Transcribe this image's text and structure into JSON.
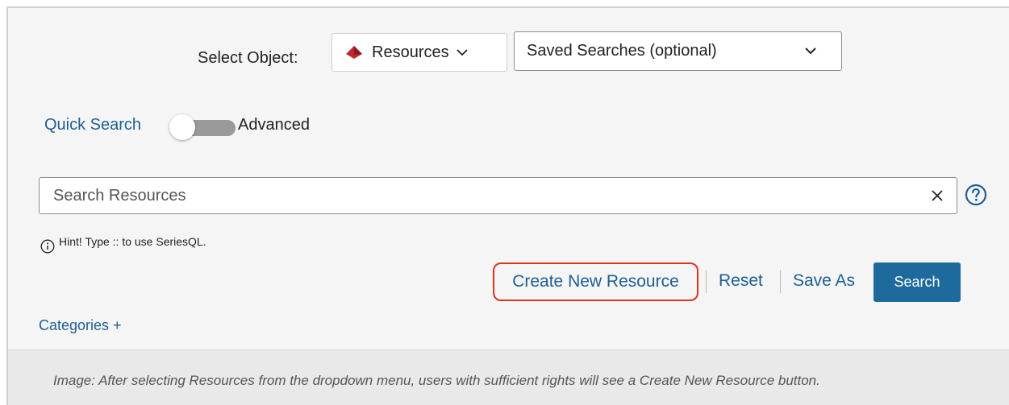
{
  "select_object": {
    "label": "Select Object:",
    "selected": "Resources",
    "icon": "resource-diamond-icon",
    "icon_color": "#c0282f"
  },
  "saved_searches": {
    "placeholder": "Saved Searches (optional)"
  },
  "mode_toggle": {
    "left_label": "Quick Search",
    "right_label": "Advanced",
    "state": "quick"
  },
  "search": {
    "placeholder": "Search Resources",
    "value": ""
  },
  "hint": {
    "text": "Hint! Type :: to use SeriesQL."
  },
  "actions": {
    "create_new": "Create New Resource",
    "reset": "Reset",
    "save_as": "Save As",
    "search": "Search"
  },
  "categories": {
    "label": "Categories +"
  },
  "caption": {
    "text": "Image: After selecting Resources from the dropdown menu, users with sufficient rights will see a Create New Resource button."
  },
  "colors": {
    "link": "#1d5f96",
    "primary_button": "#1f6a9d",
    "highlight_outline": "#e0341d",
    "background": "#f5f5f5"
  }
}
